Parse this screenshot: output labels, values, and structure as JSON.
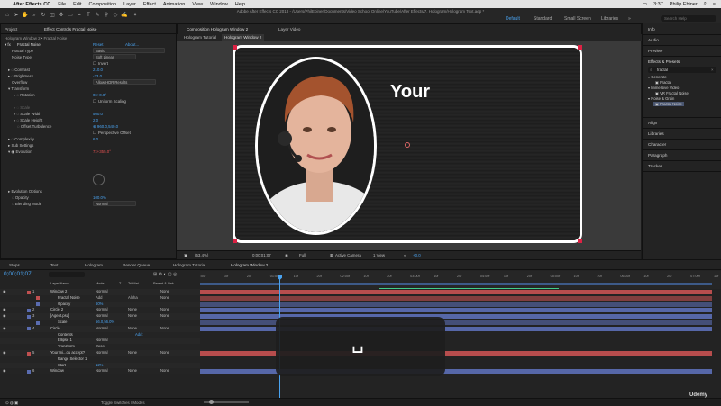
{
  "menubar": {
    "apple": "",
    "items": [
      "After Effects CC",
      "File",
      "Edit",
      "Composition",
      "Layer",
      "Effect",
      "Animation",
      "View",
      "Window",
      "Help"
    ],
    "time": "3:37",
    "user": "Philip Ebiner"
  },
  "window_title": "Adobe After Effects CC 2018 - /Users/PhilEbiner/Documents/Video School Online/YouTube/After Effects/7. Hologram/Hologram Text.aep *",
  "workspaces": {
    "default": "Default",
    "standard": "Standard",
    "small": "Small Screen",
    "libraries": "Libraries"
  },
  "search_help_placeholder": "Search Help",
  "left_panel": {
    "tabs": [
      "Project",
      "Effect Controls Fractal Noise"
    ],
    "header": "Hologram Window 2 • Fractal Noise",
    "effect": {
      "name": "Fractal Noise",
      "reset": "Reset",
      "about": "About..."
    },
    "props": [
      {
        "label": "Fractal Type",
        "value": "Basic"
      },
      {
        "label": "Noise Type",
        "value": "Soft Linear"
      },
      {
        "label": "",
        "value": "Invert"
      },
      {
        "label": "Contrast",
        "value": "210.0"
      },
      {
        "label": "Brightness",
        "value": "-33.0"
      },
      {
        "label": "Overflow",
        "value": "Allow HDR Results"
      },
      {
        "label": "Transform",
        "value": ""
      },
      {
        "label": "Rotation",
        "value": "0x+0.0°"
      },
      {
        "label": "",
        "value": "Uniform Scaling"
      },
      {
        "label": "Scale",
        "value": ""
      },
      {
        "label": "Scale Width",
        "value": "500.0"
      },
      {
        "label": "Scale Height",
        "value": "2.0"
      },
      {
        "label": "Offset Turbulence",
        "value": "960.0,540.0"
      },
      {
        "label": "",
        "value": "Perspective Offset"
      },
      {
        "label": "Complexity",
        "value": "6.0"
      },
      {
        "label": "Sub Settings",
        "value": ""
      },
      {
        "label": "Evolution",
        "value": "7x+355.0°"
      },
      {
        "label": "Evolution Options",
        "value": ""
      },
      {
        "label": "Opacity",
        "value": "100.0%"
      },
      {
        "label": "Blending Mode",
        "value": "Normal"
      }
    ]
  },
  "comp_panel": {
    "tabs": [
      "Composition Hologram Window 2",
      "Layer Video"
    ],
    "subtabs": [
      "Hologram Tutorial",
      "Hologram Window 2"
    ],
    "text": "Your",
    "zoom": "(53.4%)",
    "timecode": "0;00;01;07",
    "resolution": "Full",
    "camera": "Active Camera",
    "views": "1 View",
    "exposure": "+0.0"
  },
  "right_panel": {
    "info": "Info",
    "audio": "Audio",
    "preview": "Preview",
    "effects_presets": "Effects & Presets",
    "search_value": "fractal",
    "tree": [
      "Generate",
      "Fractal",
      "Immersive Video",
      "VR Fractal Noise",
      "Noise & Grain",
      "Fractal Noise"
    ],
    "align": "Align",
    "libraries": "Libraries",
    "character": "Character",
    "paragraph": "Paragraph",
    "tracker": "Tracker"
  },
  "timeline": {
    "tabs": [
      "Steps",
      "Text",
      "Hologram",
      "Render Queue",
      "Hologram Tutorial",
      "Hologram Window 2"
    ],
    "timecode": "0;00;01;07",
    "col_headers": [
      "Layer Name",
      "Mode",
      "T",
      "TrkMat",
      "Parent & Link"
    ],
    "ruler": [
      ":00f",
      "10f",
      "20f",
      "01:00f",
      "10f",
      "20f",
      "02:00f",
      "10f",
      "20f",
      "03:00f",
      "10f",
      "20f",
      "04:00f",
      "10f",
      "20f",
      "05:00f",
      "10f",
      "20f",
      "06:00f",
      "10f",
      "20f",
      "07:00f",
      "10f"
    ],
    "rows": [
      {
        "num": "1",
        "name": "Window 2",
        "mode": "Normal",
        "trk": "",
        "parent": "None",
        "color": "#c05050"
      },
      {
        "num": "",
        "name": "Fractal Noise",
        "mode": "Add",
        "trk": "Alpha",
        "parent": "None",
        "color": "#c05050"
      },
      {
        "num": "",
        "name": "Opacity",
        "mode": "",
        "trk": "",
        "parent": "",
        "value": "60%",
        "color": "#5a6cb0"
      },
      {
        "num": "2",
        "name": "Circle 2",
        "mode": "Normal",
        "trk": "None",
        "parent": "None",
        "color": "#5a6cb0"
      },
      {
        "num": "3",
        "name": "[Agent.psd]",
        "mode": "Normal",
        "trk": "None",
        "parent": "None",
        "color": "#5a6cb0"
      },
      {
        "num": "",
        "name": "Scale",
        "mode": "",
        "trk": "",
        "parent": "",
        "value": "56.0,56.0%",
        "color": "#5a6cb0"
      },
      {
        "num": "4",
        "name": "Circle",
        "mode": "Normal",
        "trk": "None",
        "parent": "None",
        "color": "#5a6cb0"
      },
      {
        "num": "",
        "name": "Contents",
        "mode": "",
        "trk": "",
        "parent": "",
        "add": "Add:",
        "color": ""
      },
      {
        "num": "",
        "name": "Ellipse 1",
        "mode": "Normal",
        "trk": "",
        "parent": "",
        "color": ""
      },
      {
        "num": "",
        "name": "Transform",
        "mode": "Reset",
        "trk": "",
        "parent": "",
        "color": ""
      },
      {
        "num": "5",
        "name": "Your mi...ou accept?",
        "mode": "Normal",
        "trk": "None",
        "parent": "None",
        "color": "#c05050"
      },
      {
        "num": "",
        "name": "Range Selector 1",
        "mode": "",
        "trk": "",
        "parent": "",
        "color": ""
      },
      {
        "num": "",
        "name": "Start",
        "mode": "",
        "trk": "",
        "parent": "",
        "value": "12%",
        "color": ""
      },
      {
        "num": "6",
        "name": "Window",
        "mode": "Normal",
        "trk": "None",
        "parent": "None",
        "color": "#5a6cb0"
      }
    ],
    "toggle_label": "Toggle Switches / Modes"
  },
  "overlay": {
    "key_glyph": "␣"
  },
  "watermark": "Udemy"
}
